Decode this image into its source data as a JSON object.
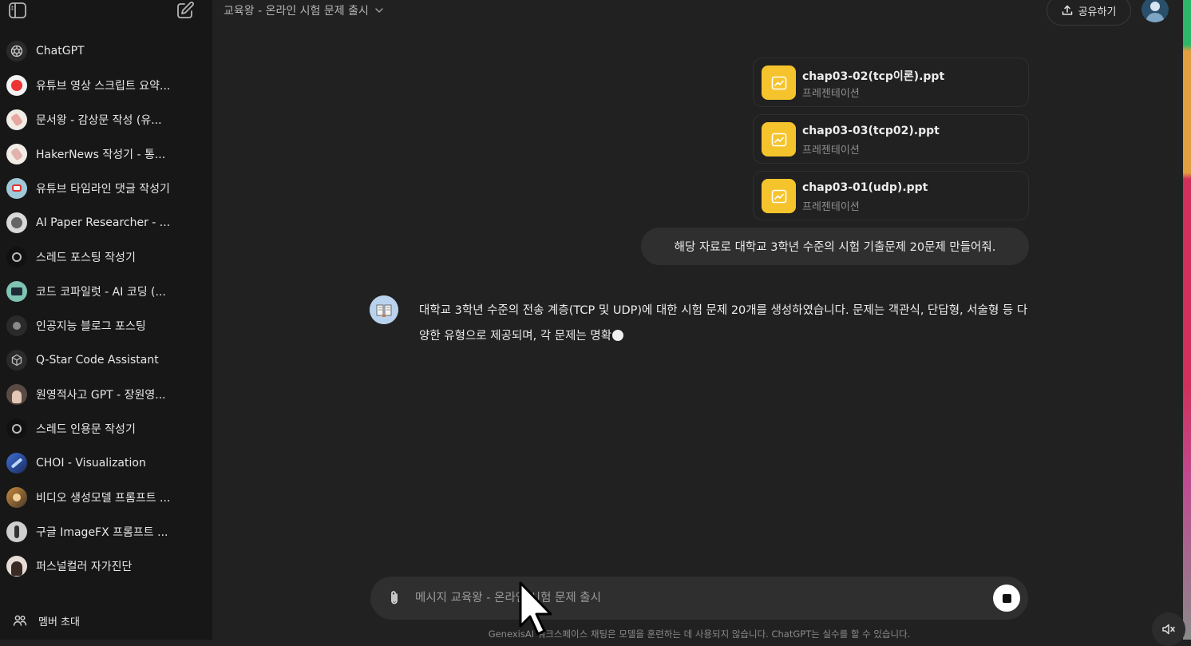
{
  "sidebar": {
    "items": [
      {
        "label": "ChatGPT",
        "icon": "openai-logo-icon"
      },
      {
        "label": "유튜브 영상 스크립트 요약...",
        "icon": "youtube-avatar-icon"
      },
      {
        "label": "문서왕 - 감상문 작성 (유...",
        "icon": "gpt-avatar-icon"
      },
      {
        "label": "HakerNews 작성기 - 통...",
        "icon": "gpt-avatar-icon"
      },
      {
        "label": "유튜브 타임라인 댓글 작성기",
        "icon": "gpt-avatar-icon"
      },
      {
        "label": "AI Paper Researcher - ...",
        "icon": "gpt-avatar-icon"
      },
      {
        "label": "스레드 포스팅 작성기",
        "icon": "gpt-avatar-icon"
      },
      {
        "label": "코드 코파일럿 - AI 코딩 (...",
        "icon": "gpt-avatar-icon"
      },
      {
        "label": "인공지능 블로그 포스팅",
        "icon": "gpt-avatar-icon"
      },
      {
        "label": "Q-Star Code Assistant",
        "icon": "gpt-avatar-icon"
      },
      {
        "label": "원영적사고 GPT - 장원영...",
        "icon": "gpt-avatar-icon"
      },
      {
        "label": "스레드 인용문 작성기",
        "icon": "gpt-avatar-icon"
      },
      {
        "label": "CHOI - Visualization",
        "icon": "gpt-avatar-icon"
      },
      {
        "label": "비디오 생성모델 프롬프트 ...",
        "icon": "gpt-avatar-icon"
      },
      {
        "label": "구글 ImageFX 프롬프트 ...",
        "icon": "gpt-avatar-icon"
      },
      {
        "label": "퍼스널컬러 자가진단",
        "icon": "gpt-avatar-icon"
      }
    ],
    "invite_label": "멤버 초대"
  },
  "header": {
    "title": "교육왕 - 온라인 시험 문제 출시",
    "share_label": "공유하기"
  },
  "attachments": [
    {
      "name": "chap03-02(tcp이론).ppt",
      "type": "프레젠테이션"
    },
    {
      "name": "chap03-03(tcp02).ppt",
      "type": "프레젠테이션"
    },
    {
      "name": "chap03-01(udp).ppt",
      "type": "프레젠테이션"
    }
  ],
  "user_message": "해당 자료로 대학교 3학년 수준의 시험 기출문제 20문제 만들어줘.",
  "assistant_message": "대학교 3학년 수준의 전송 계층(TCP 및 UDP)에 대한 시험 문제 20개를 생성하였습니다. 문제는 객관식, 단답형, 서술형 등 다양한 유형으로 제공되며, 각 문제는 명확",
  "composer": {
    "placeholder": "메시지 교육왕 - 온라인 시험 문제 출시"
  },
  "disclaimer": "GenexisAI 워크스페이스 채팅은 모델을 훈련하는 데 사용되지 않습니다. ChatGPT는 실수를 할 수 있습니다.",
  "colors": {
    "sidebar_bg": "#171717",
    "main_bg": "#212121",
    "bubble_bg": "#2f2f2f",
    "file_icon": "#f5c32c"
  }
}
